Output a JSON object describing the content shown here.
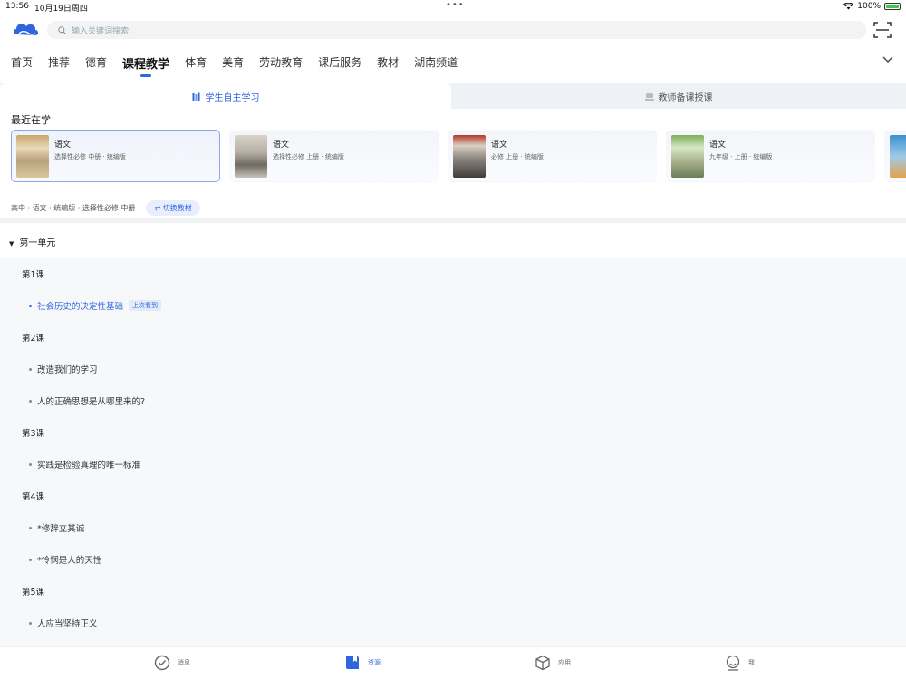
{
  "status": {
    "time": "13:56",
    "date": "10月19日周四",
    "battery": "100%"
  },
  "search": {
    "placeholder": "输入关键词搜索"
  },
  "nav": {
    "items": [
      "首页",
      "推荐",
      "德育",
      "课程教学",
      "体育",
      "美育",
      "劳动教育",
      "课后服务",
      "教材",
      "湖南频道"
    ],
    "active_index": 3
  },
  "tabs": {
    "student": "学生自主学习",
    "teacher": "教师备课授课"
  },
  "recent": {
    "title": "最近在学",
    "cards": [
      {
        "title": "语文",
        "sub": "选择性必修 中册 · 统编版"
      },
      {
        "title": "语文",
        "sub": "选择性必修 上册 · 统编版"
      },
      {
        "title": "语文",
        "sub": "必修 上册 · 统编版"
      },
      {
        "title": "语文",
        "sub": "九年级 · 上册 · 统编版"
      }
    ]
  },
  "crumb": {
    "text": "高中 · 语文 · 统编版 · 选择性必修 中册",
    "switch_label": "切换教材"
  },
  "unit": {
    "title": "第一单元"
  },
  "lessons": [
    {
      "head": "第1课"
    },
    {
      "item": "社会历史的决定性基础",
      "tag": "上次看到"
    },
    {
      "head": "第2课"
    },
    {
      "item": "改造我们的学习"
    },
    {
      "item": "人的正确思想是从哪里来的?"
    },
    {
      "head": "第3课"
    },
    {
      "item": "实践是检验真理的唯一标准"
    },
    {
      "head": "第4课"
    },
    {
      "item": "*修辞立其诚"
    },
    {
      "item": "*怜悯是人的天性"
    },
    {
      "head": "第5课"
    },
    {
      "item": "人应当坚持正义"
    }
  ],
  "bottom_nav": {
    "messages": "消息",
    "resources": "资源",
    "apps": "应用",
    "me": "我"
  },
  "colors": {
    "accent": "#2f66e0",
    "active_card_border": "#8aa8e8"
  }
}
